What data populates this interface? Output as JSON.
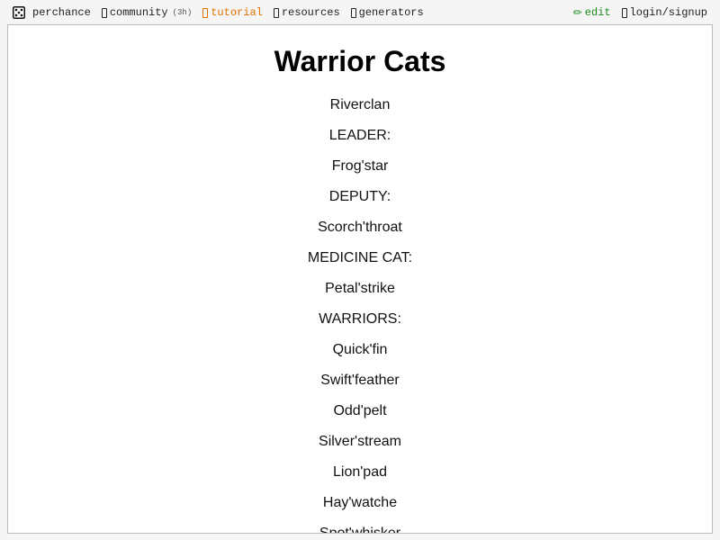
{
  "topbar": {
    "brand_label": "perchance",
    "community_label": "community",
    "community_badge": "(3h)",
    "tutorial_label": "tutorial",
    "resources_label": "resources",
    "generators_label": "generators",
    "edit_label": "edit",
    "login_label": "login/signup",
    "colors": {
      "tutorial": "#e07000",
      "edit": "#1f8a1f"
    },
    "icons": {
      "brand": "dice-icon",
      "community": "chat-icon",
      "tutorial": "book-icon",
      "resources": "folder-icon",
      "generators": "generator-icon",
      "edit": "pencil-icon",
      "login": "user-icon"
    }
  },
  "page": {
    "title": "Warrior Cats",
    "lines": [
      "Riverclan",
      "LEADER:",
      "Frog'star",
      "DEPUTY:",
      "Scorch'throat",
      "MEDICINE CAT:",
      "Petal'strike",
      "WARRIORS:",
      "Quick'fin",
      "Swift'feather",
      "Odd'pelt",
      "Silver'stream",
      "Lion'pad",
      "Hay'watche",
      "Spot'whisker"
    ]
  }
}
